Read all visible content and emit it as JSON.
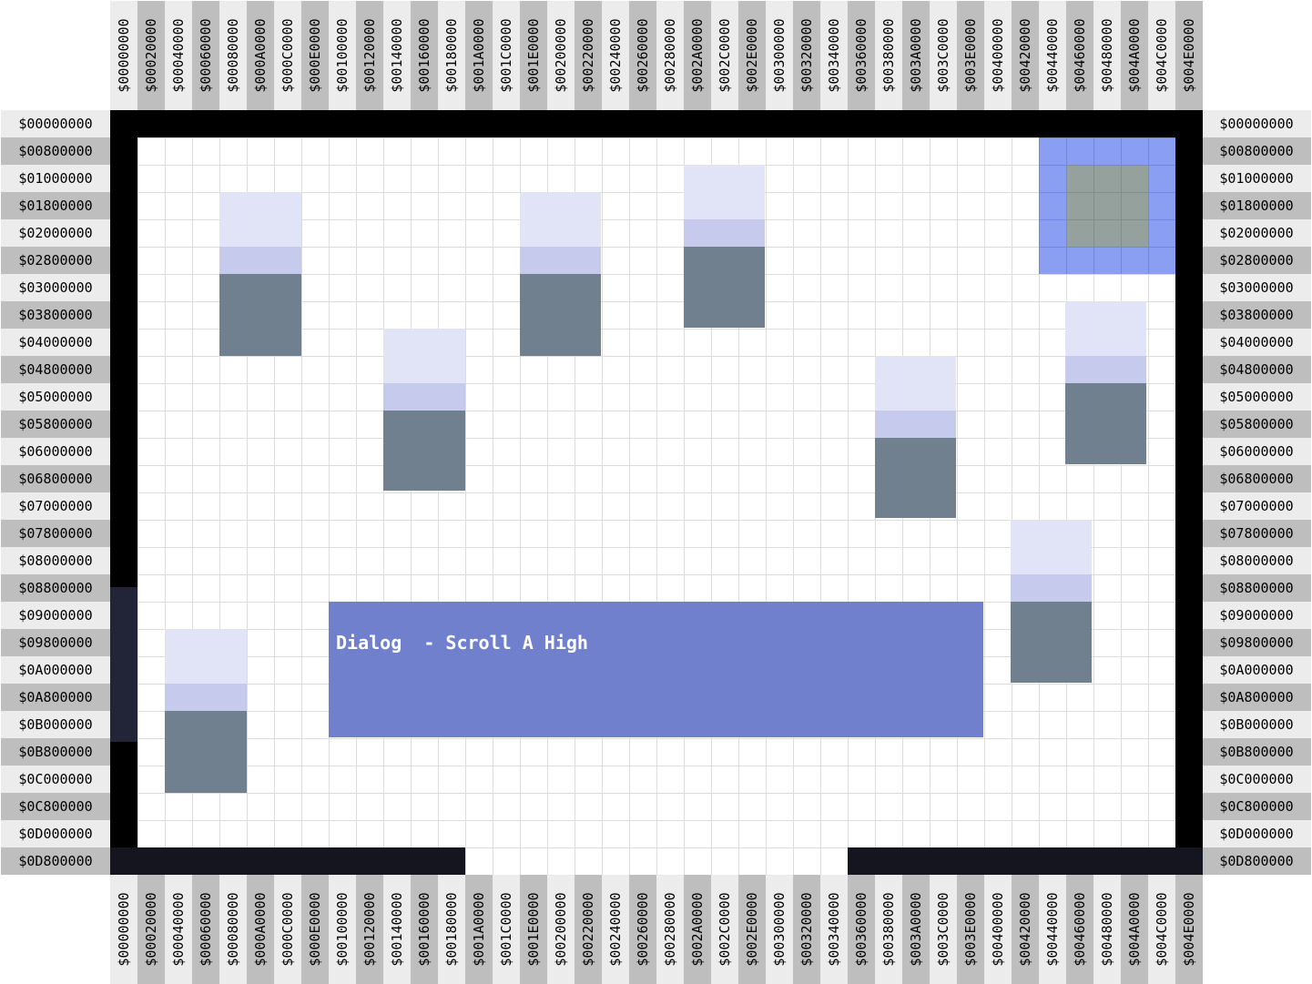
{
  "column_labels": [
    "$00000000",
    "$00020000",
    "$00040000",
    "$00060000",
    "$00080000",
    "$000A0000",
    "$000C0000",
    "$000E0000",
    "$00100000",
    "$00120000",
    "$00140000",
    "$00160000",
    "$00180000",
    "$001A0000",
    "$001C0000",
    "$001E0000",
    "$00200000",
    "$00220000",
    "$00240000",
    "$00260000",
    "$00280000",
    "$002A0000",
    "$002C0000",
    "$002E0000",
    "$00300000",
    "$00320000",
    "$00340000",
    "$00360000",
    "$00380000",
    "$003A0000",
    "$003C0000",
    "$003E0000",
    "$00400000",
    "$00420000",
    "$00440000",
    "$00460000",
    "$00480000",
    "$004A0000",
    "$004C0000",
    "$004E0000"
  ],
  "row_labels": [
    "$00000000",
    "$00800000",
    "$01000000",
    "$01800000",
    "$02000000",
    "$02800000",
    "$03000000",
    "$03800000",
    "$04000000",
    "$04800000",
    "$05000000",
    "$05800000",
    "$06000000",
    "$06800000",
    "$07000000",
    "$07800000",
    "$08000000",
    "$08800000",
    "$09000000",
    "$09800000",
    "$0A000000",
    "$0A800000",
    "$0B000000",
    "$0B800000",
    "$0C000000",
    "$0C800000",
    "$0D000000",
    "$0D800000"
  ],
  "dialog": {
    "text": "Dialog  - Scroll A High"
  },
  "colors": {
    "wall": "#000000",
    "piece_top": "#e1e4f6",
    "piece_mid": "#c6cbee",
    "piece_base": "#70808f",
    "dialog_bg": "#7180cc",
    "cursor_outer": "#8a9ff2",
    "cursor_inner": "#94a19d",
    "label_light": "#ececec",
    "label_dark": "#bebebe"
  }
}
